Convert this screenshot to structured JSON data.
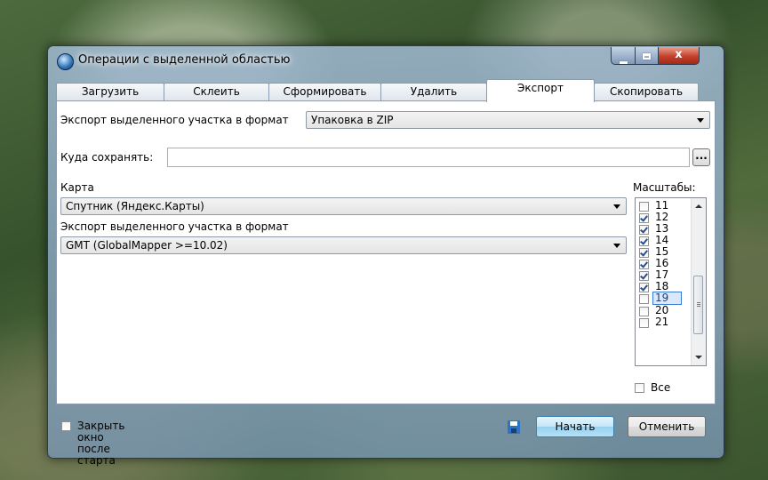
{
  "window": {
    "title": "Операции с выделенной областью",
    "close_glyph": "x"
  },
  "tabs": [
    {
      "label": "Загрузить",
      "active": false
    },
    {
      "label": "Склеить",
      "active": false
    },
    {
      "label": "Сформировать",
      "active": false
    },
    {
      "label": "Удалить",
      "active": false
    },
    {
      "label": "Экспорт",
      "active": true
    },
    {
      "label": "Скопировать",
      "active": false
    }
  ],
  "export_tab": {
    "format_label": "Экспорт выделенного участка в формат",
    "format_value": "Упаковка в ZIP",
    "save_to_label": "Куда сохранять:",
    "save_to_value": "",
    "browse_label": "...",
    "map_label": "Карта",
    "map_value": "Спутник (Яндекс.Карты)",
    "sub_format_label": "Экспорт выделенного участка в формат",
    "sub_format_value": "GMT (GlobalMapper >=10.02)",
    "scales_label": "Масштабы:",
    "scales": [
      {
        "label": "11",
        "checked": false,
        "selected": false
      },
      {
        "label": "12",
        "checked": true,
        "selected": false
      },
      {
        "label": "13",
        "checked": true,
        "selected": false
      },
      {
        "label": "14",
        "checked": true,
        "selected": false
      },
      {
        "label": "15",
        "checked": true,
        "selected": false
      },
      {
        "label": "16",
        "checked": true,
        "selected": false
      },
      {
        "label": "17",
        "checked": true,
        "selected": false
      },
      {
        "label": "18",
        "checked": true,
        "selected": false
      },
      {
        "label": "19",
        "checked": false,
        "selected": true
      },
      {
        "label": "20",
        "checked": false,
        "selected": false
      },
      {
        "label": "21",
        "checked": false,
        "selected": false
      }
    ],
    "all_label": "Все",
    "all_checked": false
  },
  "footer": {
    "close_after_start_label": "Закрыть окно после старта",
    "close_after_start_checked": false,
    "start_label": "Начать",
    "cancel_label": "Отменить"
  }
}
